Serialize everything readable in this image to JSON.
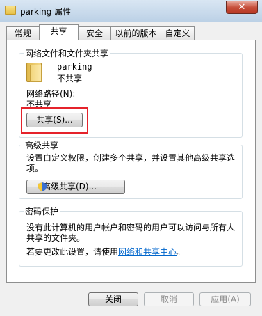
{
  "window": {
    "title": "parking 属性",
    "close_glyph": "✕"
  },
  "tabs": [
    {
      "label": "常规",
      "active": false
    },
    {
      "label": "共享",
      "active": true
    },
    {
      "label": "安全",
      "active": false
    },
    {
      "label": "以前的版本",
      "active": false
    },
    {
      "label": "自定义",
      "active": false
    }
  ],
  "network_sharing": {
    "group_title": "网络文件和文件夹共享",
    "folder_name": "parking",
    "share_status": "不共享",
    "network_path_label": "网络路径(N):",
    "network_path_value": "不共享",
    "share_button": "共享(S)..."
  },
  "advanced_sharing": {
    "group_title": "高级共享",
    "description": "设置自定义权限，创建多个共享，并设置其他高级共享选项。",
    "description_line1": "设置自定义权限，创建多个共享，并设置其他高级共享选",
    "description_line2": "项。",
    "button": "高级共享(D)...",
    "button_icon": "uac-shield-icon"
  },
  "password_protection": {
    "group_title": "密码保护",
    "line1": "没有此计算机的用户帐户和密码的用户可以访问与所有人",
    "line2": "共享的文件夹。",
    "change_prefix": "若要更改此设置，请使用",
    "link": "网络和共享中心",
    "suffix": "。"
  },
  "footer": {
    "close": "关闭",
    "cancel": "取消",
    "apply": "应用(A)"
  },
  "colors": {
    "highlight_box": "#e5232b",
    "link": "#0066cc"
  }
}
